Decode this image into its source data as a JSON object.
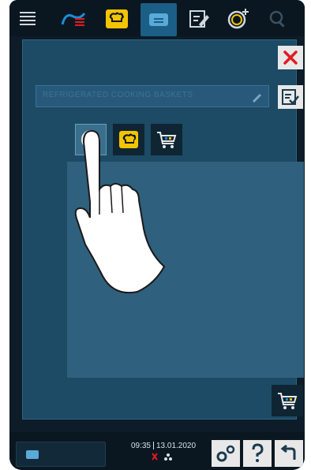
{
  "topbar": {
    "menu_icon": "menu-lines-icon",
    "tabs": [
      {
        "icon": "cooking-paths-icon"
      },
      {
        "icon": "chef-hat-icon"
      },
      {
        "icon": "cookbook-icon",
        "active": true
      },
      {
        "icon": "edit-notes-icon"
      },
      {
        "icon": "clock-plus-icon"
      },
      {
        "icon": "search-icon"
      }
    ]
  },
  "panel": {
    "close_icon": "close-x-icon",
    "name_field_value": "REFRIGERATED COOKING BASKETS",
    "confirm_icon": "edit-confirm-icon",
    "tabs": [
      {
        "icon": "red-dot-icon",
        "active": true
      },
      {
        "icon": "chef-hat-icon"
      },
      {
        "icon": "shopping-cart-icon"
      }
    ],
    "cart_button_icon": "shopping-cart-icon"
  },
  "status": {
    "time": "09:35",
    "date": "13.01.2020"
  },
  "colors": {
    "accent_red": "#e11b22",
    "accent_yellow": "#f5c400",
    "panel_blue": "#1d4a64"
  }
}
